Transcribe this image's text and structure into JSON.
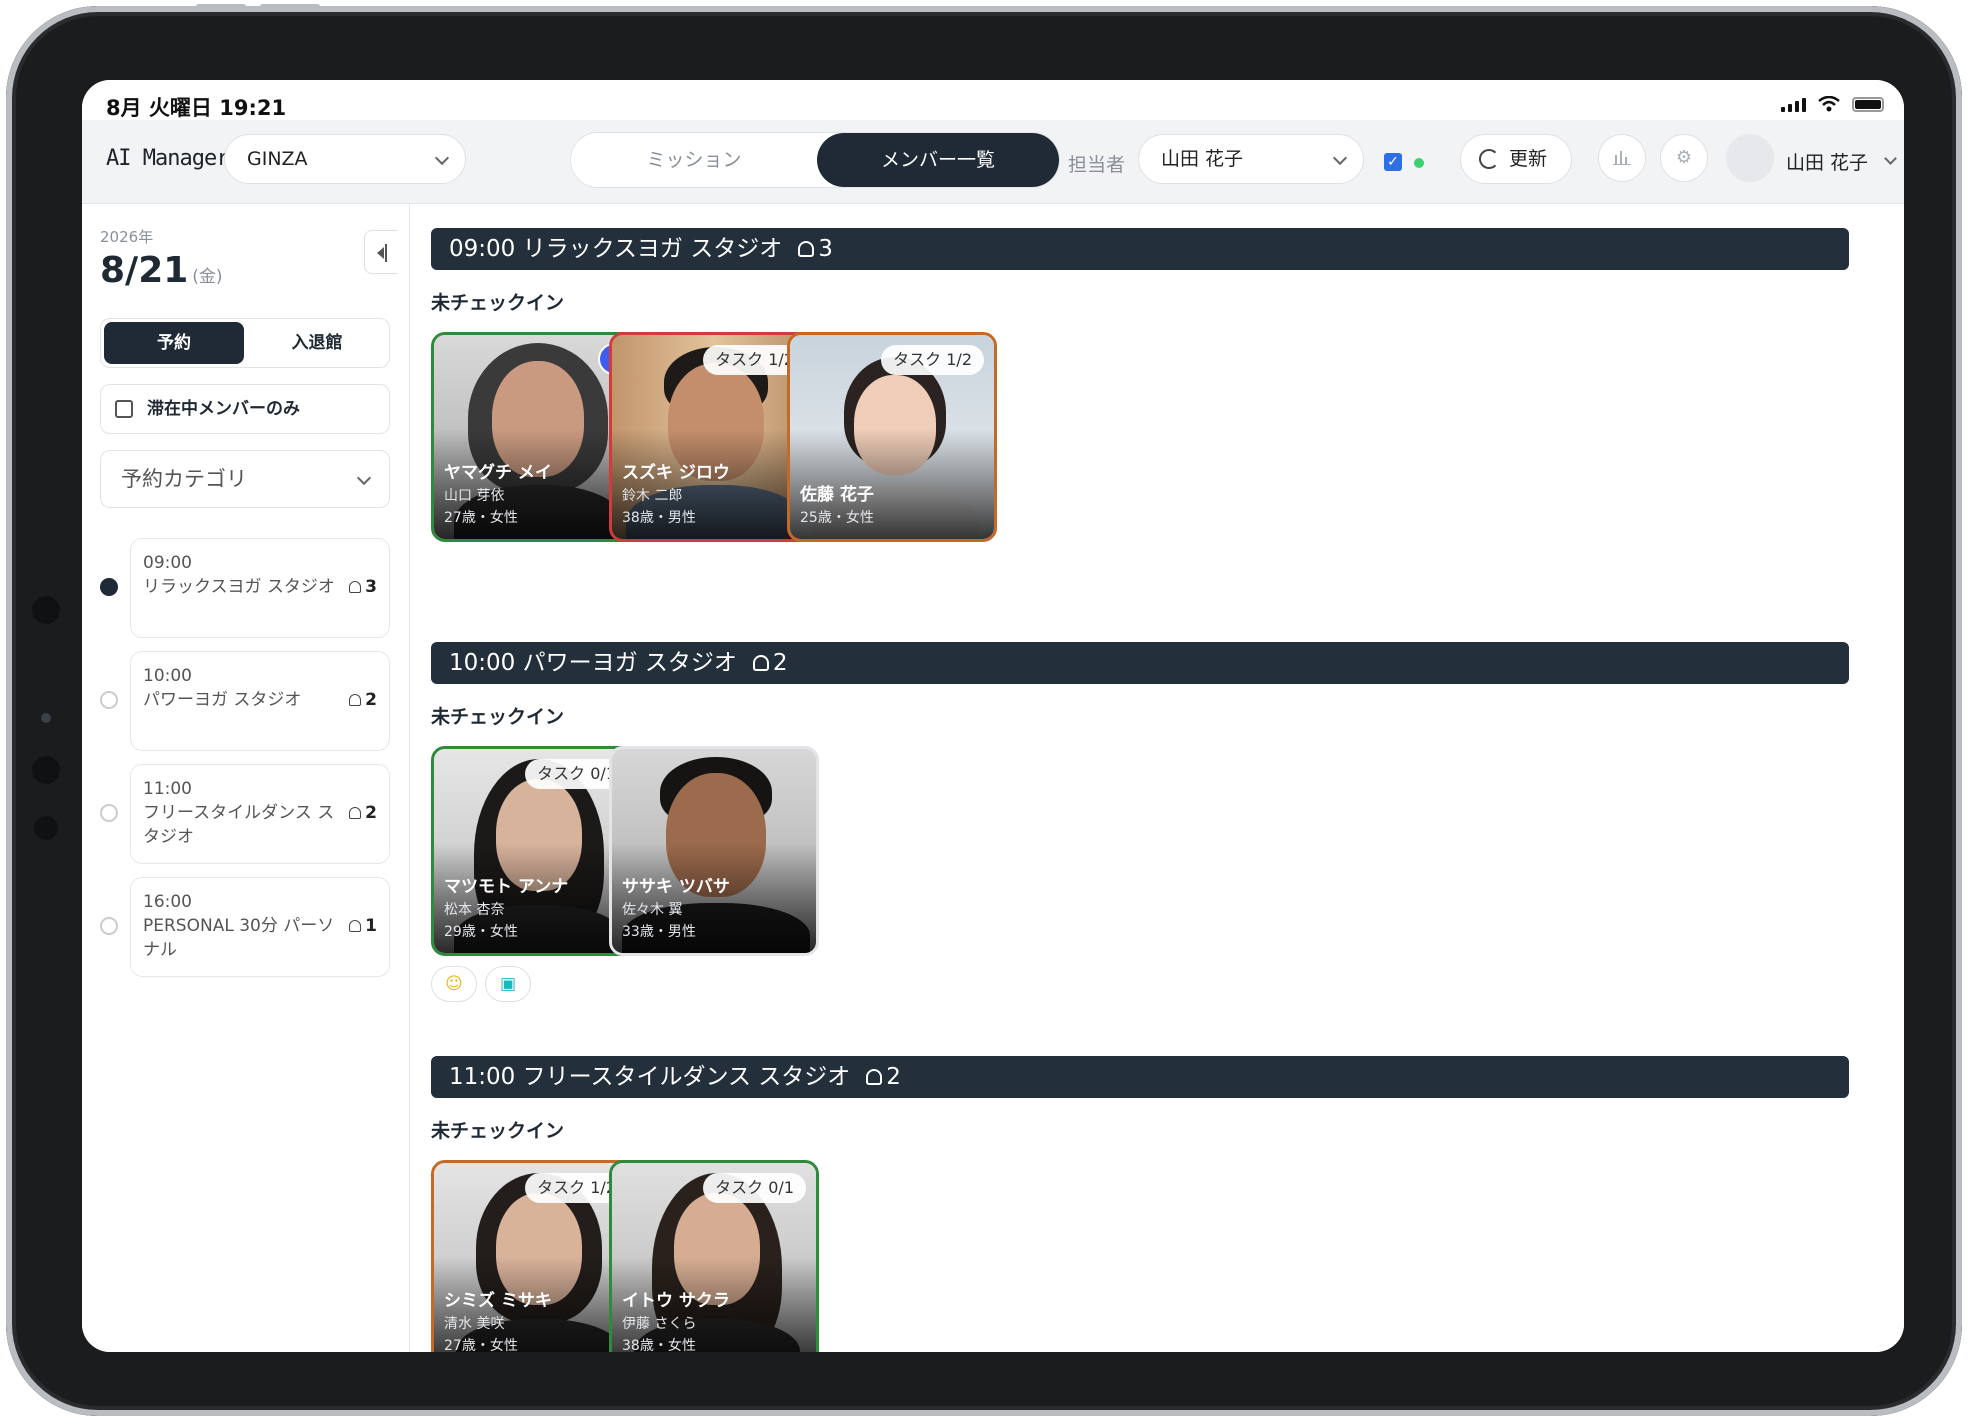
{
  "status": {
    "time": "8月 火曜日 19:21"
  },
  "toolbar": {
    "app_title": "AI Manager",
    "store": "GINZA",
    "tabs": {
      "mission": "ミッション",
      "members": "メンバー一覧"
    },
    "staff_label": "担当者",
    "staff_value": "山田 花子",
    "refresh_label": "更新",
    "user_name": "山田 花子"
  },
  "sidebar": {
    "year": "2026年",
    "date": "8/21",
    "weekday": "(金)",
    "tabs": {
      "reserve": "予約",
      "entry": "入退館"
    },
    "filter_label": "滞在中メンバーのみ",
    "category_placeholder": "予約カテゴリ",
    "schedule": [
      {
        "time": "09:00",
        "name": "リラックスヨガ スタジオ",
        "count": "3"
      },
      {
        "time": "10:00",
        "name": "パワーヨガ スタジオ",
        "count": "2"
      },
      {
        "time": "11:00",
        "name": "フリースタイルダンス スタジオ",
        "count": "2"
      },
      {
        "time": "16:00",
        "name": "PERSONAL 30分 パーソナル",
        "count": "1"
      }
    ]
  },
  "sessions": [
    {
      "title": "09:00 リラックスヨガ スタジオ",
      "count": "3",
      "label": "未チェックイン",
      "members": [
        {
          "name_kana": "ヤマグチ メイ",
          "name_kanji": "山口 芽依",
          "meta": "27歳・女性",
          "badge": ""
        },
        {
          "name_kana": "スズキ ジロウ",
          "name_kanji": "鈴木 二郎",
          "meta": "38歳・男性",
          "badge": "タスク 1/2"
        },
        {
          "name_kana": "佐藤 花子",
          "name_kanji": "",
          "meta": "25歳・女性",
          "badge": "タスク 1/2"
        }
      ]
    },
    {
      "title": "10:00 パワーヨガ スタジオ",
      "count": "2",
      "label": "未チェックイン",
      "members": [
        {
          "name_kana": "マツモト アンナ",
          "name_kanji": "松本 杏奈",
          "meta": "29歳・女性",
          "badge": "タスク 0/1"
        },
        {
          "name_kana": "ササキ ツバサ",
          "name_kanji": "佐々木 翼",
          "meta": "33歳・男性",
          "badge": ""
        }
      ]
    },
    {
      "title": "11:00 フリースタイルダンス スタジオ",
      "count": "2",
      "label": "未チェックイン",
      "members": [
        {
          "name_kana": "シミズ ミサキ",
          "name_kanji": "清水 美咲",
          "meta": "27歳・女性",
          "badge": "タスク 1/2"
        },
        {
          "name_kana": "イトウ サクラ",
          "name_kanji": "伊藤 さくら",
          "meta": "38歳・女性",
          "badge": "タスク 0/1"
        }
      ]
    }
  ],
  "colors": {
    "accent_dark": "#1f2a36",
    "checked_blue": "#3d5ef0",
    "online_green": "#3bd16f"
  }
}
